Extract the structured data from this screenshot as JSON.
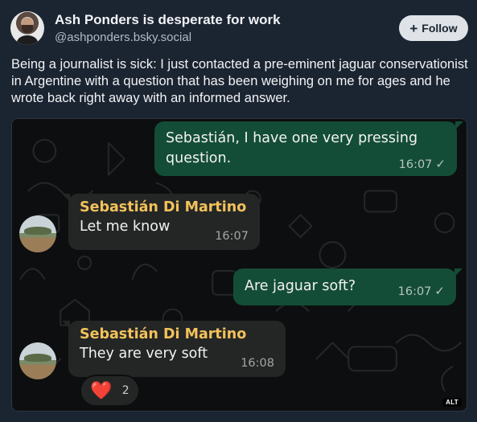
{
  "author": {
    "display_name": "Ash Ponders is desperate for work",
    "handle": "@ashponders.bsky.social",
    "avatar_icon": "profile-photo"
  },
  "follow": {
    "icon": "plus-icon",
    "icon_glyph": "+",
    "label": "Follow"
  },
  "post": {
    "text": "Being a journalist is sick: I just contacted a pre-eminent jaguar conservationist in Argentine with a question that has been weighing on me for ages and he wrote back right away with an informed answer."
  },
  "chat": {
    "messages": [
      {
        "direction": "outgoing",
        "text": "Sebastián, I have one very pressing question.",
        "time": "16:07",
        "status_icon": "check-icon",
        "status_glyph": "✓"
      },
      {
        "direction": "incoming",
        "sender": "Sebastián Di Martino",
        "text": "Let me know",
        "time": "16:07"
      },
      {
        "direction": "outgoing",
        "text": "Are jaguar soft?",
        "time": "16:07",
        "status_icon": "check-icon",
        "status_glyph": "✓"
      },
      {
        "direction": "incoming",
        "sender": "Sebastián Di Martino",
        "text": "They are very soft",
        "time": "16:08"
      }
    ],
    "reaction": {
      "icon": "heart-icon",
      "glyph": "❤️",
      "count": "2"
    }
  },
  "media": {
    "alt_badge": "ALT"
  },
  "colors": {
    "background": "#1b2431",
    "outgoing_bubble": "#144d37",
    "incoming_bubble": "#242626",
    "sender_name": "#f2c15a",
    "follow_button": "#dfe3e8"
  }
}
